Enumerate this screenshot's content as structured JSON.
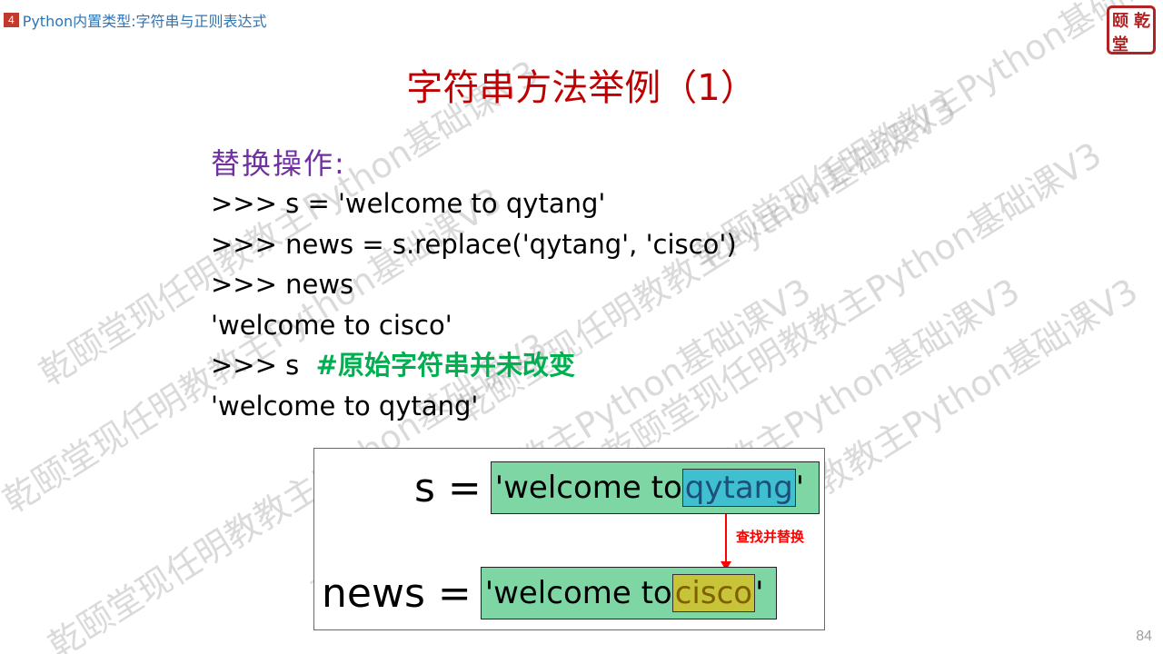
{
  "header": {
    "chapter_number": "4",
    "chapter_title": "Python内置类型:字符串与正则表达式",
    "seal_chars": [
      "颐",
      "乾",
      "堂",
      ""
    ]
  },
  "slide": {
    "title": "字符串方法举例（1）",
    "subtitle": "替换操作:",
    "lines": [
      ">>> s = 'welcome to qytang'",
      ">>> news = s.replace('qytang', 'cisco')",
      ">>> news",
      "'welcome to cisco'",
      ">>> s",
      "'welcome to qytang'"
    ],
    "comment": "#原始字符串并未改变"
  },
  "diagram": {
    "row1": {
      "lhs": "s =",
      "prefix": "'welcome to ",
      "highlight": "qytang",
      "suffix": "'"
    },
    "row2": {
      "lhs": "news =",
      "prefix": "'welcome to ",
      "highlight": "cisco",
      "suffix": "'"
    },
    "arrow_label": "查找并替换"
  },
  "watermark_text": "乾颐堂现任明教教主Python基础课V3",
  "page_number": "84",
  "colors": {
    "title": "#c00000",
    "subtitle": "#7030a0",
    "comment": "#00b050",
    "string_box": "#7ed6a5",
    "highlight_old": "#3fbfd0",
    "highlight_new": "#c7c43a",
    "arrow": "#ff0000"
  }
}
